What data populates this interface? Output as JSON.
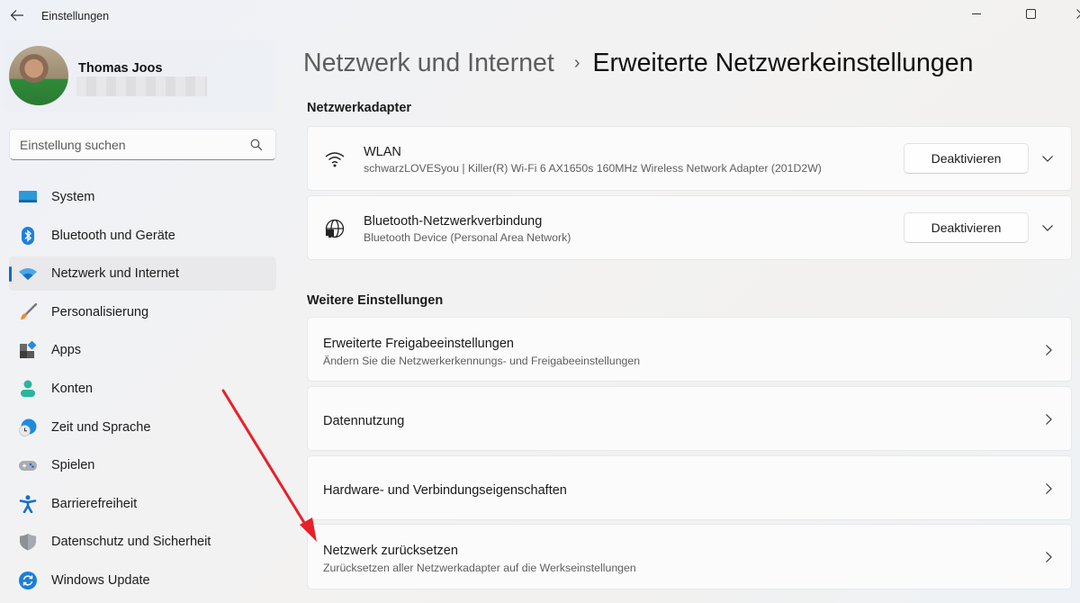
{
  "window": {
    "app_title": "Einstellungen",
    "controls": [
      "minimize",
      "maximize",
      "close"
    ]
  },
  "profile": {
    "name": "Thomas Joos",
    "email": "(redacted)"
  },
  "search": {
    "placeholder": "Einstellung suchen"
  },
  "sidebar": {
    "items": [
      {
        "label": "System",
        "icon": "system-icon",
        "active": false
      },
      {
        "label": "Bluetooth und Geräte",
        "icon": "bluetooth-icon",
        "active": false
      },
      {
        "label": "Netzwerk und Internet",
        "icon": "wifi-icon",
        "active": true
      },
      {
        "label": "Personalisierung",
        "icon": "brush-icon",
        "active": false
      },
      {
        "label": "Apps",
        "icon": "apps-icon",
        "active": false
      },
      {
        "label": "Konten",
        "icon": "account-icon",
        "active": false
      },
      {
        "label": "Zeit und Sprache",
        "icon": "time-language-icon",
        "active": false
      },
      {
        "label": "Spielen",
        "icon": "gamepad-icon",
        "active": false
      },
      {
        "label": "Barrierefreiheit",
        "icon": "accessibility-icon",
        "active": false
      },
      {
        "label": "Datenschutz und Sicherheit",
        "icon": "shield-icon",
        "active": false
      },
      {
        "label": "Windows Update",
        "icon": "update-icon",
        "active": false
      }
    ]
  },
  "breadcrumb": {
    "parent": "Netzwerk und Internet",
    "separator": "›",
    "current": "Erweiterte Netzwerkeinstellungen"
  },
  "adapters": {
    "title": "Netzwerkadapter",
    "items": [
      {
        "name": "WLAN",
        "description": "schwarzLOVESyou | Killer(R) Wi-Fi 6 AX1650s 160MHz Wireless Network Adapter (201D2W)",
        "button": "Deaktivieren",
        "icon": "wifi-icon"
      },
      {
        "name": "Bluetooth-Netzwerkverbindung",
        "description": "Bluetooth Device (Personal Area Network)",
        "button": "Deaktivieren",
        "icon": "globe-network-icon"
      }
    ]
  },
  "more_settings": {
    "title": "Weitere Einstellungen",
    "items": [
      {
        "title": "Erweiterte Freigabeeinstellungen",
        "subtitle": "Ändern Sie die Netzwerkerkennungs- und Freigabeeinstellungen"
      },
      {
        "title": "Datennutzung",
        "subtitle": ""
      },
      {
        "title": "Hardware- und Verbindungseigenschaften",
        "subtitle": ""
      },
      {
        "title": "Netzwerk zurücksetzen",
        "subtitle": "Zurücksetzen aller Netzwerkadapter auf die Werkseinstellungen"
      }
    ]
  },
  "annotation": {
    "type": "arrow",
    "color": "#e8202a",
    "points_to": "Netzwerk zurücksetzen"
  }
}
